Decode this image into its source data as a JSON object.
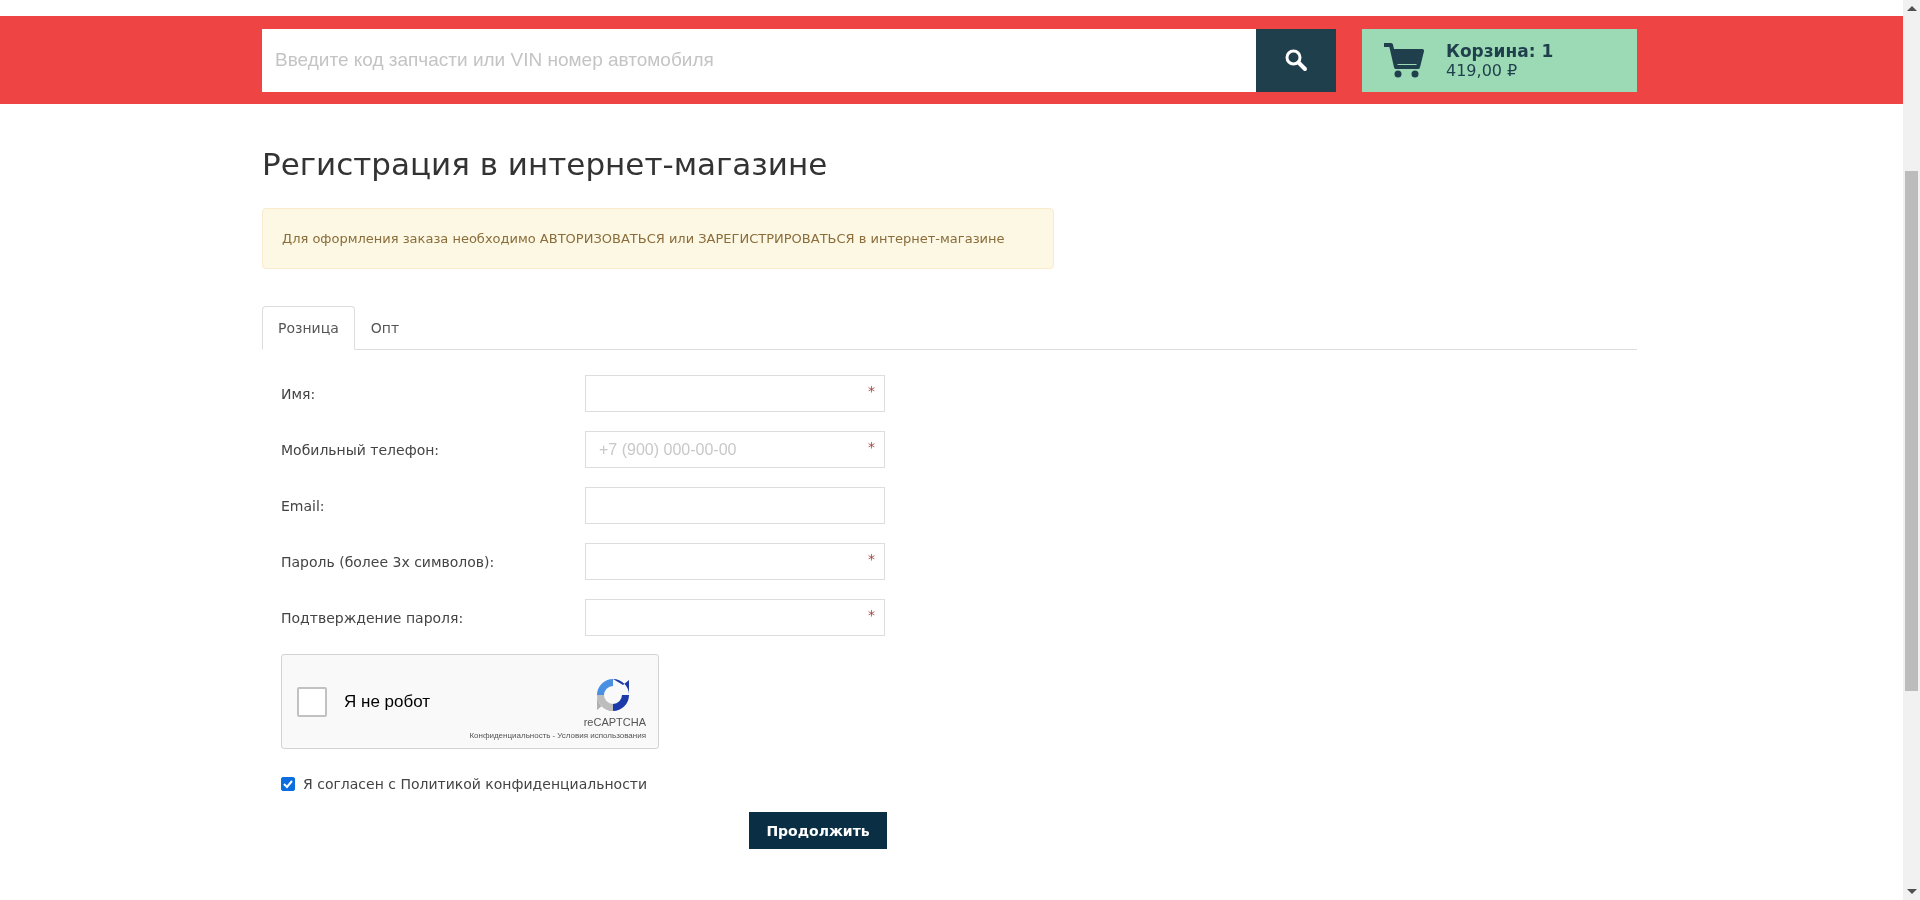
{
  "header": {
    "search": {
      "placeholder": "Введите код запчасти или VIN номер автомобиля"
    },
    "cart": {
      "title": "Корзина: 1",
      "total": "419,00 ₽"
    }
  },
  "page_title": "Регистрация в интернет-магазине",
  "alert": "Для оформления заказа необходимо АВТОРИЗОВАТЬСЯ или ЗАРЕГИСТРИРОВАТЬСЯ в интернет-магазине",
  "tabs": [
    {
      "label": "Розница",
      "selected": true
    },
    {
      "label": "Опт",
      "selected": false
    }
  ],
  "fields": [
    {
      "label": "Имя:",
      "required_mark": "*"
    },
    {
      "label": "Мобильный телефон:",
      "placeholder": "+7 (900) 000-00-00",
      "required_mark": "*"
    },
    {
      "label": "Email:"
    },
    {
      "label": "Пароль (более 3х символов):",
      "required_mark": "*"
    },
    {
      "label": "Подтверждение пароля:",
      "required_mark": "*"
    }
  ],
  "captcha": {
    "label": "Я не робот",
    "checked": false,
    "brand": "reCAPTCHA",
    "privacy_link": "Конфиденциальность",
    "separator": "-",
    "terms_link": "Условия использования"
  },
  "consent": {
    "label": "Я согласен с Политикой конфиденциальности",
    "checked": true
  },
  "submit_button": "Продолжить"
}
